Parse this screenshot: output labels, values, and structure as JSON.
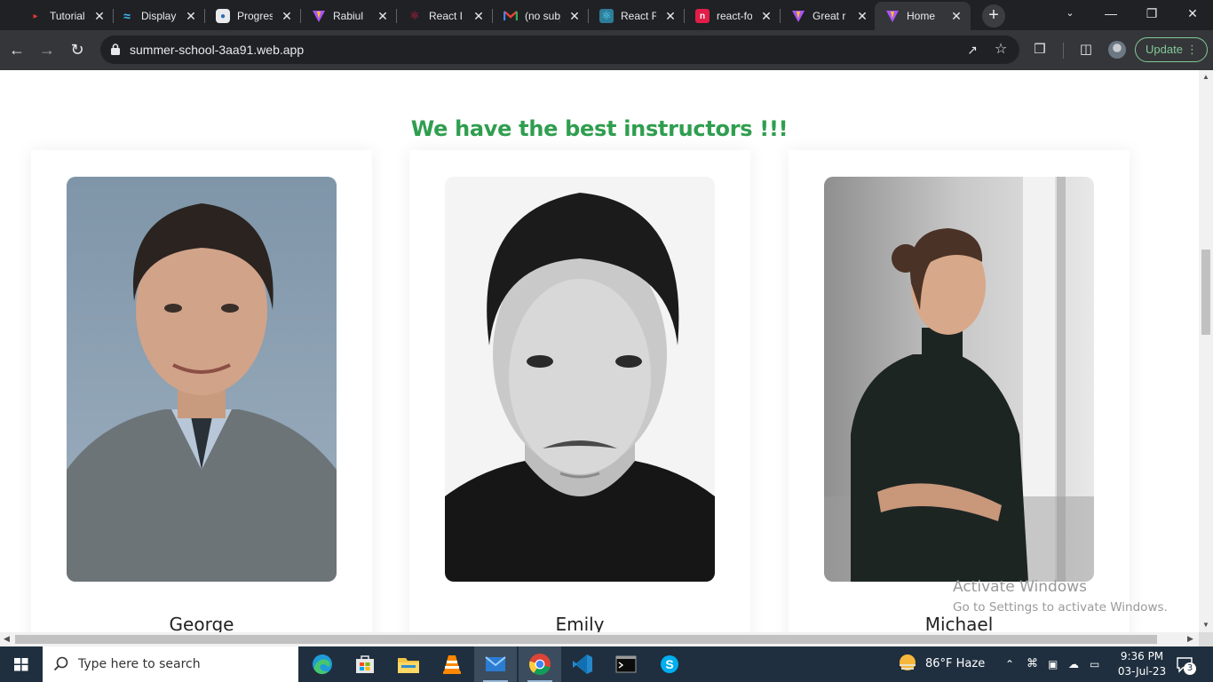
{
  "browser": {
    "tabs": [
      {
        "title": "Tutorials",
        "favicon_color": "#e53935"
      },
      {
        "title": "Display",
        "favicon_color": "#38bdf8"
      },
      {
        "title": "Progress",
        "favicon_color": "#2b6cb0"
      },
      {
        "title": "Rabiul",
        "favicon_color": "#a855f7"
      },
      {
        "title": "React I",
        "favicon_color": "#e11d48"
      },
      {
        "title": "(no subject)",
        "favicon_color": "#ea4335"
      },
      {
        "title": "React F",
        "favicon_color": "#61dafb"
      },
      {
        "title": "react-fo",
        "favicon_color": "#e11d48"
      },
      {
        "title": "Great r",
        "favicon_color": "#a855f7"
      },
      {
        "title": "Home",
        "favicon_color": "#a855f7"
      }
    ],
    "active_tab_index": 9,
    "url": "summer-school-3aa91.web.app",
    "update_label": "Update"
  },
  "page": {
    "heading": "We have the best instructors !!!",
    "instructors": [
      {
        "name": "George"
      },
      {
        "name": "Emily"
      },
      {
        "name": "Michael"
      }
    ]
  },
  "watermark": {
    "line1": "Activate Windows",
    "line2": "Go to Settings to activate Windows."
  },
  "taskbar": {
    "search_placeholder": "Type here to search",
    "weather": "86°F  Haze",
    "time": "9:36 PM",
    "date": "03-Jul-23",
    "notification_count": "3"
  },
  "colors": {
    "accent_green": "#2f9e4f",
    "chrome_dark": "#202124",
    "toolbar": "#35363a"
  }
}
